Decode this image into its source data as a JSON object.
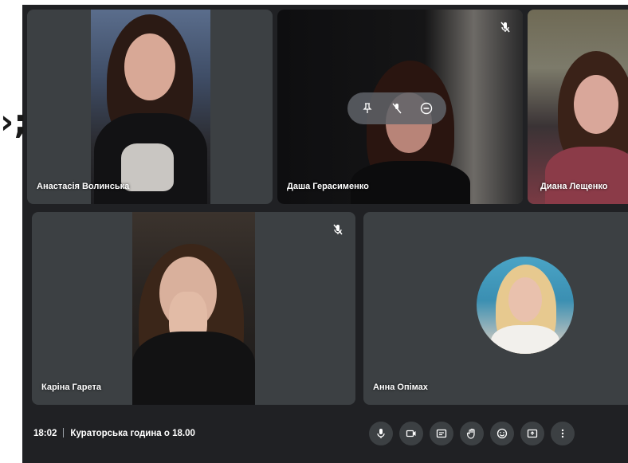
{
  "overlay": {
    "glyph": "›;"
  },
  "participants": [
    {
      "name": "Анастасія Волинська"
    },
    {
      "name": "Даша Герасименко"
    },
    {
      "name": "Диана Лещенко"
    },
    {
      "name": "Каріна Гарета"
    },
    {
      "name": "Анна Опімах"
    }
  ],
  "meeting": {
    "time": "18:02",
    "title": "Кураторська година о 18.00"
  },
  "controls": [
    {
      "icon": "mic-icon"
    },
    {
      "icon": "camera-icon"
    },
    {
      "icon": "captions-icon"
    },
    {
      "icon": "raise-hand-icon"
    },
    {
      "icon": "emoji-icon"
    },
    {
      "icon": "present-screen-icon"
    },
    {
      "icon": "more-options-icon"
    }
  ],
  "tile_hover_controls": [
    {
      "icon": "pin-icon"
    },
    {
      "icon": "mute-mic-icon"
    },
    {
      "icon": "remove-icon"
    }
  ],
  "colors": {
    "background": "#202124",
    "tile": "#3c4043",
    "control_button": "#3c4043",
    "text": "#ffffff"
  }
}
